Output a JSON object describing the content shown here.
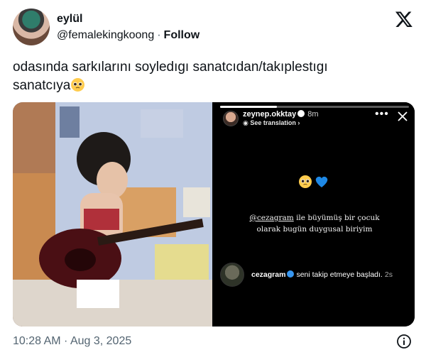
{
  "author": {
    "name": "eylül",
    "handle": "@femalekingkoong",
    "separator": "·",
    "follow_label": "Follow"
  },
  "tweet": {
    "text_line1": "odasında sarkılarını soyledıgı sanatcıdan/takıplestıgı",
    "text_line2": "sanatcıya",
    "emoji": "pleading-face"
  },
  "media": {
    "left_photo": "girl-playing-guitar-photo",
    "story": {
      "username": "zeynep.okktay",
      "time": "8m",
      "translate_label": "See translation",
      "translate_chevron": "›",
      "more_glyph": "•••",
      "emojis": [
        "pleading-face",
        "blue-heart"
      ],
      "mention": "@cezagram",
      "text_rest": " ile büyümüş bir çocuk",
      "text_line2": "olarak bugün duygusal biriyim",
      "notification": {
        "username": "cezagram",
        "action": "seni takip etmeye başladı.",
        "ago": "2s"
      }
    }
  },
  "footer": {
    "timestamp": "10:28 AM · Aug 3, 2025"
  },
  "colors": {
    "text": "#0f1419",
    "secondary": "#536471",
    "verified_blue": "#3897f0"
  }
}
